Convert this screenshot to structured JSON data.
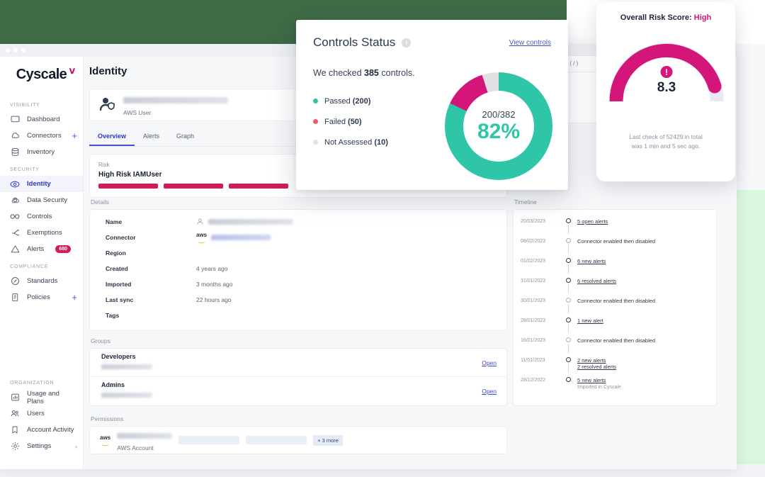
{
  "window": {
    "dots": 3
  },
  "brand": {
    "name": "Cyscale",
    "mark": "∨"
  },
  "sidebar": {
    "sections": [
      {
        "label": "VISIBILITY",
        "items": [
          {
            "label": "Dashboard",
            "icon": "monitor-icon",
            "trailing": ""
          },
          {
            "label": "Connectors",
            "icon": "cloud-icon",
            "trailing": "+"
          },
          {
            "label": "Inventory",
            "icon": "database-icon",
            "trailing": ""
          }
        ]
      },
      {
        "label": "SECURITY",
        "items": [
          {
            "label": "Identity",
            "icon": "eye-icon",
            "trailing": "",
            "active": true
          },
          {
            "label": "Data Security",
            "icon": "cloud-lock-icon",
            "trailing": ""
          },
          {
            "label": "Controls",
            "icon": "infinity-icon",
            "trailing": ""
          },
          {
            "label": "Exemptions",
            "icon": "branch-icon",
            "trailing": ""
          },
          {
            "label": "Alerts",
            "icon": "warning-triangle-icon",
            "badge": "680"
          }
        ]
      },
      {
        "label": "COMPLIANCE",
        "items": [
          {
            "label": "Standards",
            "icon": "compass-icon",
            "trailing": ""
          },
          {
            "label": "Policies",
            "icon": "document-icon",
            "trailing": "+"
          }
        ]
      },
      {
        "label": "ORGANIZATION",
        "items": [
          {
            "label": "Usage and Plans",
            "icon": "bar-chart-icon",
            "trailing": ""
          },
          {
            "label": "Users",
            "icon": "users-icon",
            "trailing": ""
          },
          {
            "label": "Account Activity",
            "icon": "bookmark-icon",
            "trailing": ""
          },
          {
            "label": "Settings",
            "icon": "gear-icon",
            "trailing": "›"
          }
        ]
      }
    ]
  },
  "page": {
    "title": "Identity",
    "identity": {
      "email_redacted": true,
      "type": "AWS User"
    },
    "tabs": [
      {
        "label": "Overview",
        "active": true
      },
      {
        "label": "Alerts",
        "active": false
      },
      {
        "label": "Graph",
        "active": false
      }
    ],
    "risk": {
      "label": "Risk",
      "value": "High Risk IAMUser",
      "bars": 3,
      "bar_color": "#d21c55"
    }
  },
  "details": {
    "section_label": "Details",
    "rows": [
      {
        "key": "Name",
        "value": "",
        "redacted": true,
        "icon": "user-icon"
      },
      {
        "key": "Connector",
        "value": "",
        "redacted": true,
        "icon": "aws-icon"
      },
      {
        "key": "Region",
        "value": ""
      },
      {
        "key": "Created",
        "value": "4 years ago"
      },
      {
        "key": "Imported",
        "value": "3 months ago"
      },
      {
        "key": "Last sync",
        "value": "22 hours ago"
      },
      {
        "key": "Tags",
        "value": ""
      }
    ]
  },
  "groups": {
    "section_label": "Groups",
    "rows": [
      {
        "name": "Developers",
        "sub_redacted": true,
        "action": "Open"
      },
      {
        "name": "Admins",
        "sub_redacted": true,
        "action": "Open"
      }
    ]
  },
  "permissions": {
    "section_label": "Permissions",
    "row": {
      "provider": "aws",
      "name_redacted": true,
      "type": "AWS Account",
      "chips": 2,
      "more_label": "+ 3 more"
    }
  },
  "timeline": {
    "section_label": "Timeline",
    "events": [
      {
        "date": "20/03/2023",
        "primary": "5 open alerts",
        "link": true,
        "secondary": "",
        "solid": true
      },
      {
        "date": "08/02/2023",
        "primary": "Connector enabled then disabled",
        "link": false,
        "secondary": "",
        "solid": false
      },
      {
        "date": "01/02/2023",
        "primary": "6 new alerts",
        "link": true,
        "secondary": "",
        "solid": true
      },
      {
        "date": "31/01/2023",
        "primary": "6 resolved alerts",
        "link": true,
        "secondary": "",
        "solid": true
      },
      {
        "date": "30/01/2023",
        "primary": "Connector enabled then disabled",
        "link": false,
        "secondary": "",
        "solid": false
      },
      {
        "date": "28/01/2023",
        "primary": "1 new alert",
        "link": true,
        "secondary": "",
        "solid": true
      },
      {
        "date": "16/01/2023",
        "primary": "Connector enabled then disabled",
        "link": false,
        "secondary": "",
        "solid": false
      },
      {
        "date": "11/01/2023",
        "primary": "2 new alerts",
        "link": true,
        "secondary": "2 resolved alerts",
        "secondary_link": true,
        "solid": true
      },
      {
        "date": "28/12/2022",
        "primary": "5 new alerts",
        "link": true,
        "secondary": "Imported in Cyscale",
        "secondary_link": false,
        "solid": true
      }
    ]
  },
  "controls_modal": {
    "title": "Controls Status",
    "info_icon": "info-icon",
    "view_link": "View controls",
    "checked_prefix": "We checked ",
    "checked_count": "385",
    "checked_suffix": " controls.",
    "legend": [
      {
        "label": "Passed",
        "count": "(200)",
        "color": "#2fc6a8"
      },
      {
        "label": "Failed",
        "count": "(50)",
        "color": "#ef5b63"
      },
      {
        "label": "Not Assessed",
        "count": "(10)",
        "color": "#dfe1e4"
      }
    ],
    "ratio": "200/382",
    "percent": "82%"
  },
  "risk_panel": {
    "title_prefix": "Overall Risk Score: ",
    "title_value": "High",
    "value": "8.3",
    "badge": "!",
    "footer_line1": "Last check of 52429 in total",
    "footer_line2": "was 1 min and 5 sec ago."
  },
  "behind_panel": {
    "partial_text": "rces ( / )"
  },
  "chart_data": [
    {
      "type": "pie",
      "title": "Controls Status",
      "categories": [
        "Passed",
        "Failed",
        "Not Assessed"
      ],
      "values": [
        200,
        50,
        10
      ],
      "colors": [
        "#2fc6a8",
        "#d4157a",
        "#dfe1e4"
      ],
      "center_label": "200/382",
      "center_value": "82%",
      "total_checked": 385,
      "legend_position": "left"
    },
    {
      "type": "bar",
      "title": "Overall Risk Score",
      "categories": [
        "Risk"
      ],
      "values": [
        8.3
      ],
      "ylim": [
        0,
        10
      ],
      "rating": "High",
      "color": "#d4157a"
    }
  ]
}
